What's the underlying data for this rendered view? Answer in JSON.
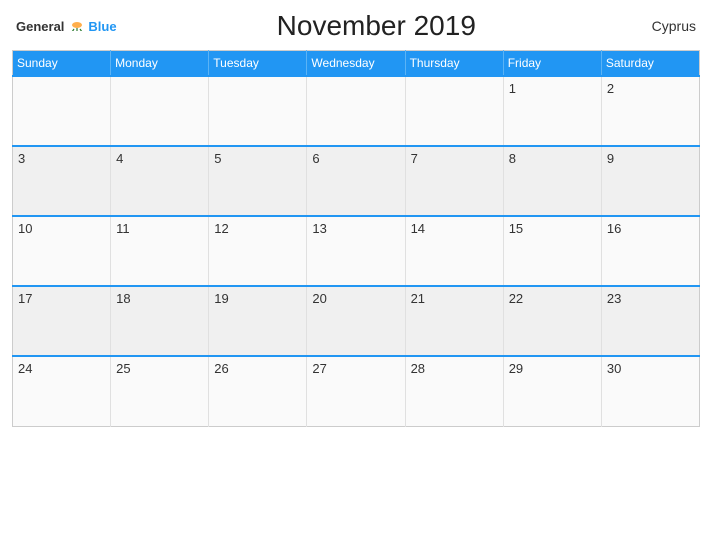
{
  "header": {
    "logo_general": "General",
    "logo_blue": "Blue",
    "title": "November 2019",
    "country": "Cyprus"
  },
  "weekdays": [
    "Sunday",
    "Monday",
    "Tuesday",
    "Wednesday",
    "Thursday",
    "Friday",
    "Saturday"
  ],
  "weeks": [
    [
      null,
      null,
      null,
      null,
      null,
      1,
      2
    ],
    [
      3,
      4,
      5,
      6,
      7,
      8,
      9
    ],
    [
      10,
      11,
      12,
      13,
      14,
      15,
      16
    ],
    [
      17,
      18,
      19,
      20,
      21,
      22,
      23
    ],
    [
      24,
      25,
      26,
      27,
      28,
      29,
      30
    ]
  ]
}
